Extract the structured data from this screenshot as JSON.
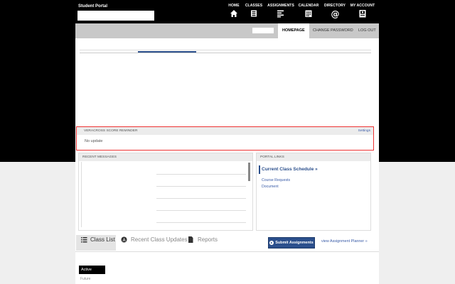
{
  "portal": {
    "title": "Student Portal"
  },
  "topnav": [
    {
      "label": "HOME",
      "icon": "home-icon"
    },
    {
      "label": "CLASSES",
      "icon": "classes-icon"
    },
    {
      "label": "ASSIGNMENTS",
      "icon": "assignments-icon"
    },
    {
      "label": "CALENDAR",
      "icon": "calendar-icon"
    },
    {
      "label": "DIRECTORY",
      "icon": "at-icon"
    },
    {
      "label": "MY ACCOUNT",
      "icon": "account-icon"
    }
  ],
  "tabs": {
    "home": "HOMEPAGE",
    "password": "CHANGE PASSWORD",
    "logout": "LOG OUT"
  },
  "reminder": {
    "title": "VERACROSS SCORE REMINDER",
    "settings": "Settings",
    "value": "No update"
  },
  "messages": {
    "title": "RECENT MESSAGES"
  },
  "links": {
    "title": "PORTAL LINKS",
    "main": "Current Class Schedule »",
    "items": [
      "Course Requests",
      "Document"
    ]
  },
  "bottom": {
    "class_list": "Class List",
    "recent_updates": "Recent Class Updates",
    "reports": "Reports",
    "submit": "Submit Assignments",
    "planner": "view Assignment Planner »",
    "active": "Active",
    "future": "Future"
  },
  "colors": {
    "accent": "#2b4f8c",
    "reminder_border": "#e33333",
    "topbar": "#000000"
  }
}
